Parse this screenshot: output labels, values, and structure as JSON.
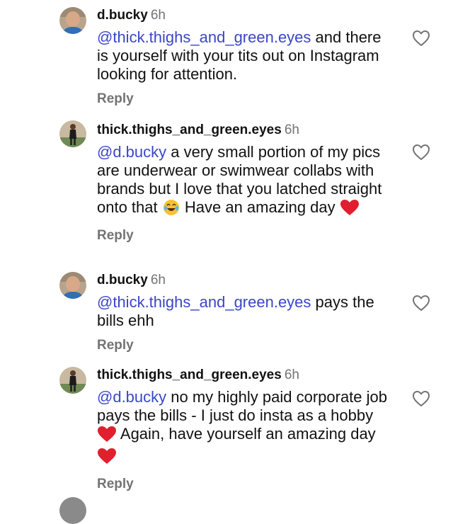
{
  "comments": [
    {
      "username": "d.bucky",
      "time": "6h",
      "mention": "@thick.thighs_and_green.eyes",
      "text": " and there is yourself with your tits out on Instagram looking for attention.",
      "reply_label": "Reply",
      "avatar": "bald-man-avatar"
    },
    {
      "username": "thick.thighs_and_green.eyes",
      "time": "6h",
      "mention": "@d.bucky",
      "text_before_emoji": " a very small portion of my pics are underwear or swimwear collabs with brands but I love that you latched straight onto that ",
      "emoji_1": "face-with-tears-of-joy",
      "text_after_emoji": " Have an amazing day ",
      "emoji_2": "red-heart",
      "reply_label": "Reply",
      "avatar": "woman-full-body-avatar"
    },
    {
      "username": "d.bucky",
      "time": "6h",
      "mention": "@thick.thighs_and_green.eyes",
      "text": " pays the bills ehh",
      "reply_label": "Reply",
      "avatar": "bald-man-avatar"
    },
    {
      "username": "thick.thighs_and_green.eyes",
      "time": "6h",
      "mention": "@d.bucky",
      "text_before_emoji": " no my highly paid corporate job pays the bills - I just do insta as a hobby ",
      "emoji_1": "red-heart",
      "text_after_emoji": " Again, have yourself an amazing day ",
      "emoji_2": "red-heart",
      "reply_label": "Reply",
      "avatar": "woman-full-body-avatar"
    }
  ],
  "colors": {
    "mention": "#3a46c9",
    "meta_gray": "#737373",
    "text": "#111111",
    "heart_red": "#e0202e"
  },
  "icons": {
    "like": "heart-outline-icon"
  }
}
